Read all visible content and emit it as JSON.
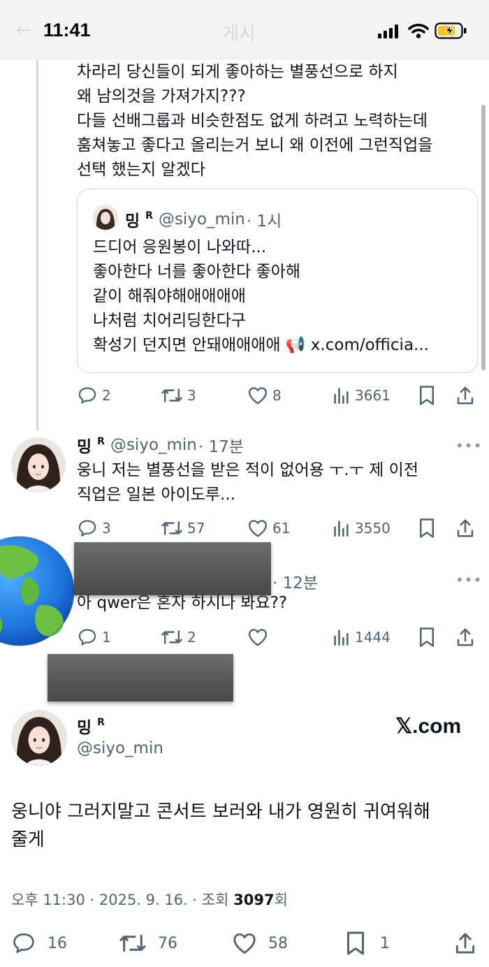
{
  "status_bar": {
    "time": "11:41",
    "ghost_title": "게시",
    "ghost_back": "←"
  },
  "tweet1": {
    "lines": [
      "차라리 당신들이 되게 좋아하는 별풍선으로 하지",
      "왜 남의것을 가져가지???",
      "다들 선배그룹과 비슷한점도 없게 하려고 노력하는데",
      "훔쳐놓고 좋다고 올리는거 보니 왜 이전에 그런직업을",
      "선택 했는지 알겠다"
    ],
    "quote": {
      "name": "밍",
      "badge": "R",
      "handle": "@siyo_min",
      "time": "· 1시",
      "lines": [
        "드디어 응원봉이 나와따...",
        "좋아한다 너를 좋아한다 좋아해",
        "같이 해줘야해애애애애",
        "나처럼 치어리딩한다구",
        "확성기 던지면 안돼애애애애 📢 x.com/officia..."
      ]
    },
    "actions": {
      "replies": "2",
      "retweets": "3",
      "likes": "8",
      "views": "3661"
    }
  },
  "tweet2": {
    "name": "밍",
    "badge": "R",
    "handle": "@siyo_min",
    "time": "· 17분",
    "more": "•••",
    "lines": [
      "웅니 저는 별풍선을 받은 적이 없어용 ㅜ.ㅜ 제 이전",
      "직업은 일본 아이도루..."
    ],
    "actions": {
      "replies": "3",
      "retweets": "57",
      "likes": "61",
      "views": "3550"
    }
  },
  "tweet3": {
    "time": "· 12분",
    "more": "•••",
    "text": "아 qwer은 혼자 하시나 봐요??",
    "actions": {
      "replies": "1",
      "retweets": "2",
      "likes": "",
      "views": "1444"
    }
  },
  "main_tweet": {
    "name": "밍",
    "badge": "R",
    "handle": "@siyo_min",
    "logo": "𝕏.com",
    "lines": [
      "웅니야 그러지말고 콘서트 보러와 내가 영원히 귀여워해",
      "줄게"
    ],
    "meta_prefix": "오후 11:30 · 2025. 9. 16. · 조회 ",
    "meta_views": "3097",
    "meta_suffix": "회",
    "actions": {
      "replies": "16",
      "retweets": "76",
      "likes": "58",
      "bookmarks": "1"
    }
  },
  "colors": {
    "text": "#0f1419",
    "muted": "#536471",
    "border": "#cfd9de",
    "status_bg": "#f4f4f4",
    "battery": "#f5c518"
  }
}
